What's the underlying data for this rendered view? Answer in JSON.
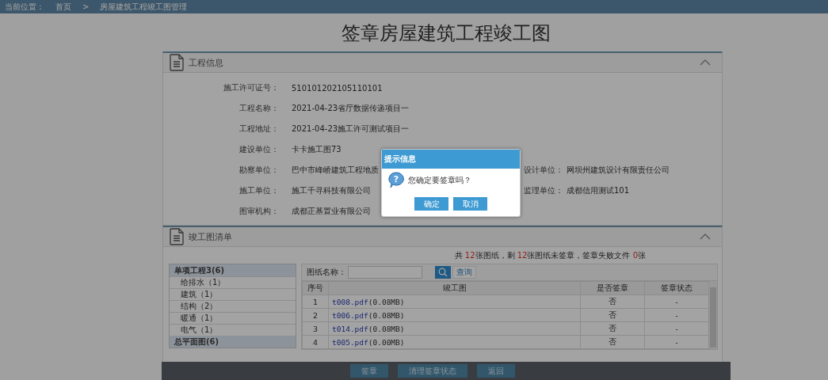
{
  "breadcrumb": {
    "label": "当前位置：",
    "separator": ">",
    "items": [
      "首页",
      "房屋建筑工程竣工图管理"
    ]
  },
  "title": "签章房屋建筑工程竣工图",
  "project_info": {
    "title": "工程信息",
    "rows": [
      [
        {
          "label": "施工许可证号：",
          "value": "510101202105110101"
        }
      ],
      [
        {
          "label": "工程名称：",
          "value": "2021-04-23省厅数据传递项目一"
        }
      ],
      [
        {
          "label": "工程地址：",
          "value": "2021-04-23施工许可测试项目一"
        }
      ],
      [
        {
          "label": "建设单位：",
          "value": "卡卡施工图73"
        }
      ],
      [
        {
          "label": "勘察单位：",
          "value": "巴中市峰峤建筑工程地质"
        },
        {
          "label": "设计单位：",
          "value": "网坝州建筑设计有限责任公司"
        }
      ],
      [
        {
          "label": "施工单位：",
          "value": "施工千寻科技有限公司"
        },
        {
          "label": "监理单位：",
          "value": "成都信用测试101"
        }
      ],
      [
        {
          "label": "图审机构：",
          "value": "成都正基置业有限公司"
        }
      ]
    ]
  },
  "drawing_list": {
    "title": "竣工图清单",
    "summary": [
      {
        "text": "共",
        "highlight": false
      },
      {
        "text": "12",
        "highlight": true
      },
      {
        "text": "张图纸，剩",
        "highlight": false
      },
      {
        "text": "12",
        "highlight": true
      },
      {
        "text": "张图纸未签章，签章失败文件",
        "highlight": false
      },
      {
        "text": "0",
        "highlight": true
      },
      {
        "text": "张",
        "highlight": false
      }
    ],
    "sidebar": [
      {
        "label": "单项工程3(6)",
        "kind": "group"
      },
      {
        "label": "给排水（1）",
        "kind": "item"
      },
      {
        "label": "建筑（1）",
        "kind": "item"
      },
      {
        "label": "结构（2）",
        "kind": "item"
      },
      {
        "label": "暖通（1）",
        "kind": "item"
      },
      {
        "label": "电气（1）",
        "kind": "item"
      },
      {
        "label": "总平面图(6)",
        "kind": "group"
      }
    ],
    "search": {
      "label": "图纸名称：",
      "button": "查询"
    },
    "table": {
      "columns": [
        "序号",
        "竣工图",
        "是否签章",
        "签章状态"
      ],
      "rows": [
        {
          "index": "1",
          "file": "t008.pdf",
          "size": "(0.08MB)",
          "signed": "否",
          "status": "-"
        },
        {
          "index": "2",
          "file": "t006.pdf",
          "size": "(0.08MB)",
          "signed": "否",
          "status": "-"
        },
        {
          "index": "3",
          "file": "t014.pdf",
          "size": "(0.08MB)",
          "signed": "否",
          "status": "-"
        },
        {
          "index": "4",
          "file": "t005.pdf",
          "size": "(0.00MB)",
          "signed": "否",
          "status": "-"
        }
      ]
    }
  },
  "action_bar": {
    "buttons": [
      "签章",
      "清理签章状态",
      "返回"
    ]
  },
  "dialog": {
    "title": "提示信息",
    "icon": "?",
    "message": "您确定要签章吗？",
    "buttons": [
      "确定",
      "取消"
    ]
  }
}
